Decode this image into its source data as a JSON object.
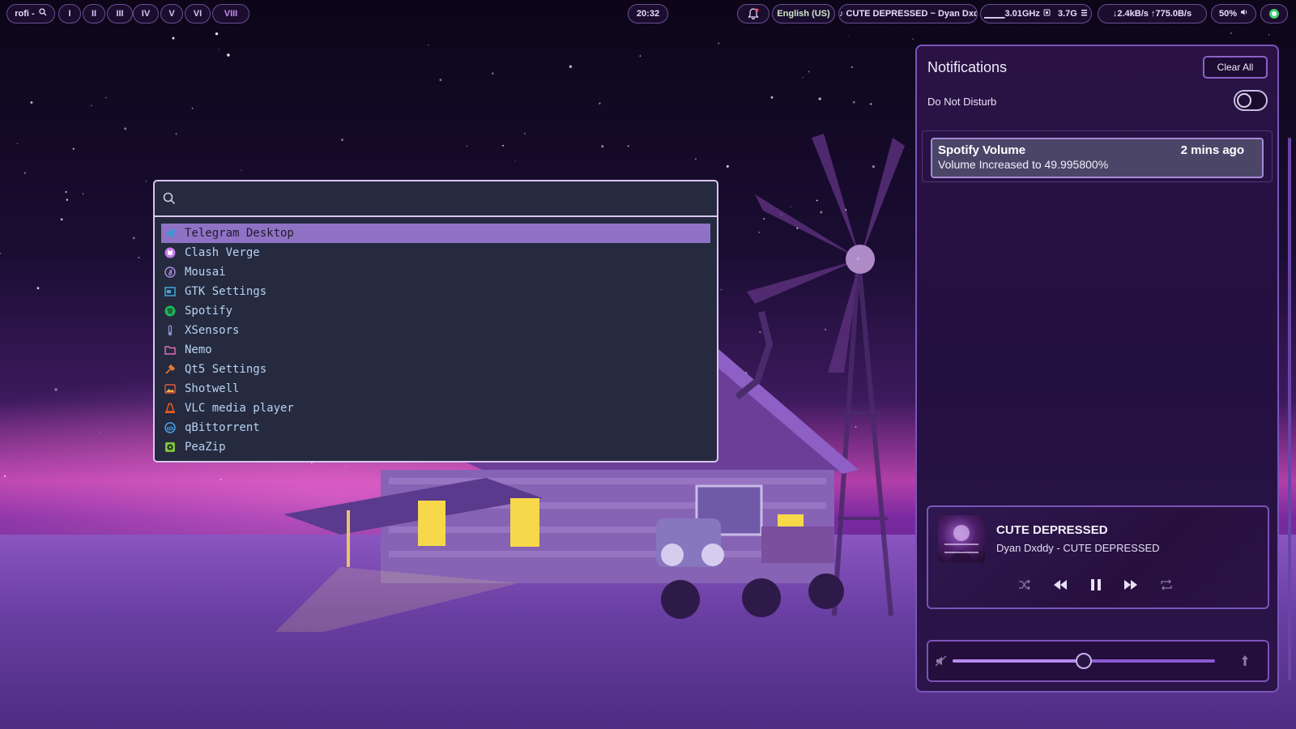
{
  "topbar": {
    "launcher_label": "rofi -",
    "workspaces": [
      "I",
      "II",
      "III",
      "IV",
      "V",
      "VI",
      "VIII"
    ],
    "active_workspace": "VIII",
    "clock": "20:32",
    "keyboard_layout": "English (US)",
    "now_playing": "♪ CUTE DEPRESSED ~ Dyan Dxddy",
    "cpu": "▁▁▁3.01GHz",
    "memory": "3.7G",
    "network": "↓2.4kB/s ↑775.0B/s",
    "volume": "50%"
  },
  "rofi": {
    "search_value": "",
    "selected_index": 0,
    "apps": [
      {
        "label": "Telegram Desktop",
        "icon": "telegram-icon",
        "color": "#2aa1da"
      },
      {
        "label": "Clash Verge",
        "icon": "clash-verge-icon",
        "color": "#c77ae8"
      },
      {
        "label": "Mousai",
        "icon": "mousai-icon",
        "color": "#a58ad6"
      },
      {
        "label": "GTK Settings",
        "icon": "gtk-settings-icon",
        "color": "#3fa6d9"
      },
      {
        "label": "Spotify",
        "icon": "spotify-icon",
        "color": "#1db954"
      },
      {
        "label": "XSensors",
        "icon": "xsensors-icon",
        "color": "#8d8fd8"
      },
      {
        "label": "Nemo",
        "icon": "nemo-folder-icon",
        "color": "#e36db8"
      },
      {
        "label": "Qt5 Settings",
        "icon": "qt5-settings-icon",
        "color": "#e07a3c"
      },
      {
        "label": "Shotwell",
        "icon": "shotwell-icon",
        "color": "#e25a3c"
      },
      {
        "label": "VLC media player",
        "icon": "vlc-icon",
        "color": "#f05a23"
      },
      {
        "label": "qBittorrent",
        "icon": "qbittorrent-icon",
        "color": "#4aa3e8"
      },
      {
        "label": "PeaZip",
        "icon": "peazip-icon",
        "color": "#7fc33c"
      }
    ]
  },
  "notifications": {
    "title": "Notifications",
    "clear_all_label": "Clear All",
    "dnd_label": "Do Not Disturb",
    "dnd_enabled": false,
    "items": [
      {
        "app": "Spotify Volume",
        "time": "2 mins ago",
        "body": "Volume Increased to 49.995800%"
      }
    ]
  },
  "player": {
    "title": "CUTE DEPRESSED",
    "subtitle": "Dyan Dxddy - CUTE DEPRESSED",
    "volume_fraction": 0.5
  }
}
